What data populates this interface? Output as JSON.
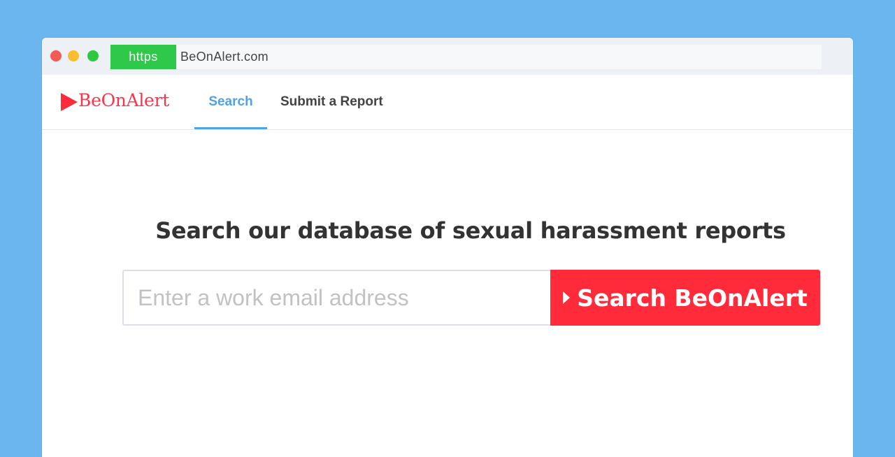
{
  "browser": {
    "https_label": "https",
    "url": "BeOnAlert.com"
  },
  "navbar": {
    "logo_text": "BeOnAlert",
    "tabs": [
      {
        "label": "Search",
        "active": true
      },
      {
        "label": "Submit a Report",
        "active": false
      }
    ]
  },
  "main": {
    "headline": "Search our database of sexual harassment reports",
    "search": {
      "placeholder": "Enter a work email address",
      "value": "",
      "button_label": "Search BeOnAlert",
      "button_icon": "caret-right-icon"
    }
  },
  "colors": {
    "background": "#6bb6ee",
    "brand": "#ff2a3a",
    "active_tab": "#4ea3e6",
    "https_badge": "#2ec84a"
  }
}
